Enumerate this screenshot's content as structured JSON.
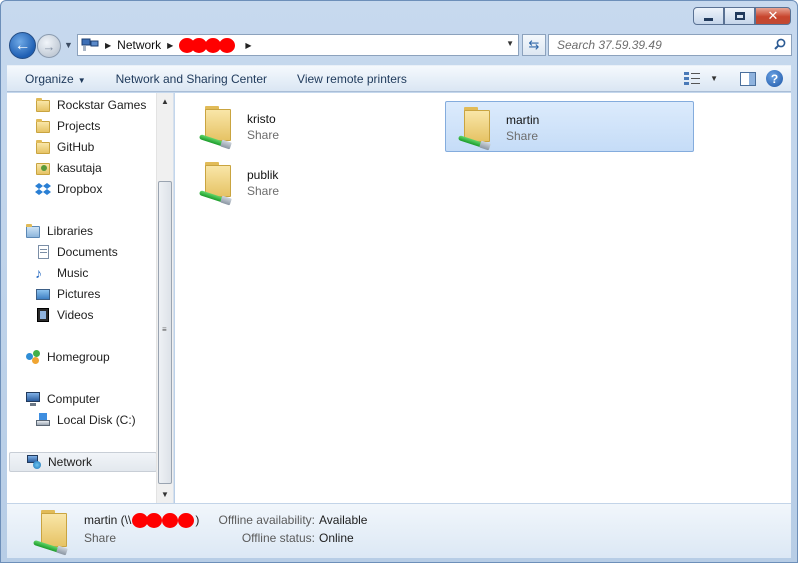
{
  "window": {
    "caption_buttons": {
      "minimize": "minimize",
      "maximize": "maximize",
      "close": "✕"
    }
  },
  "address": {
    "root_crumb": "Network",
    "redaction_color": "#ff0000"
  },
  "search": {
    "placeholder": "Search 37.59.39.49"
  },
  "toolbar": {
    "organize": "Organize",
    "network_sharing": "Network and Sharing Center",
    "remote_printers": "View remote printers"
  },
  "nav": {
    "items": [
      {
        "label": "Rockstar Games",
        "icon": "folder-icon"
      },
      {
        "label": "Projects",
        "icon": "folder-icon"
      },
      {
        "label": "GitHub",
        "icon": "folder-icon"
      },
      {
        "label": "kasutaja",
        "icon": "user-folder-icon"
      },
      {
        "label": "Dropbox",
        "icon": "dropbox-icon"
      },
      {
        "label": "Libraries",
        "icon": "libraries-icon"
      },
      {
        "label": "Documents",
        "icon": "documents-icon"
      },
      {
        "label": "Music",
        "icon": "music-icon"
      },
      {
        "label": "Pictures",
        "icon": "pictures-icon"
      },
      {
        "label": "Videos",
        "icon": "videos-icon"
      },
      {
        "label": "Homegroup",
        "icon": "homegroup-icon"
      },
      {
        "label": "Computer",
        "icon": "computer-icon"
      },
      {
        "label": "Local Disk (C:)",
        "icon": "local-disk-icon"
      },
      {
        "label": "Network",
        "icon": "network-icon",
        "selected": true
      }
    ]
  },
  "shares": [
    {
      "name": "kristo",
      "type": "Share"
    },
    {
      "name": "martin",
      "type": "Share",
      "selected": true
    },
    {
      "name": "publik",
      "type": "Share"
    }
  ],
  "details": {
    "name_prefix": "martin (\\\\",
    "name_suffix": ")",
    "type": "Share",
    "offline_availability_label": "Offline availability:",
    "offline_availability_value": "Available",
    "offline_status_label": "Offline status:",
    "offline_status_value": "Online"
  },
  "colors": {
    "selection_fill": "#c5dcf7",
    "selection_border": "#84acdd",
    "window_frame": "#b7cde6"
  }
}
